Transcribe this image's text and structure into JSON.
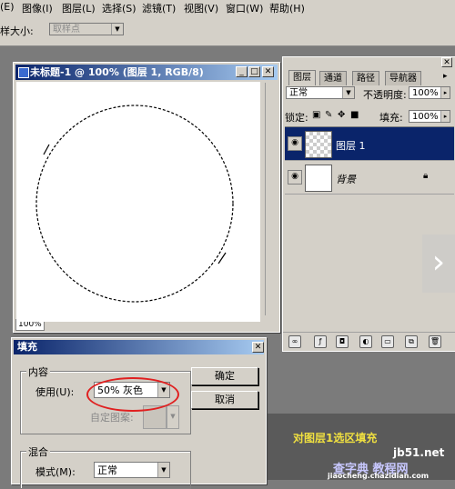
{
  "menu": {
    "items": [
      "(E)",
      "图像(I)",
      "图层(L)",
      "选择(S)",
      "滤镜(T)",
      "视图(V)",
      "窗口(W)",
      "帮助(H)"
    ]
  },
  "options": {
    "sample_label": "样大小:",
    "sample_value": "取样点"
  },
  "document": {
    "title": "未标题-1 @ 100% (图层 1, RGB/8)",
    "zoom": "100%"
  },
  "layers_panel": {
    "tabs": [
      "图层",
      "通道",
      "路径",
      "导航器"
    ],
    "blend_mode": "正常",
    "opacity_label": "不透明度:",
    "opacity_value": "100%",
    "lock_label": "锁定:",
    "fill_label": "填充:",
    "fill_value": "100%",
    "layers": [
      {
        "name": "图层 1",
        "selected": true
      },
      {
        "name": "背景",
        "selected": false
      }
    ]
  },
  "fill_dialog": {
    "title": "填充",
    "content_group": "内容",
    "use_label": "使用(U):",
    "use_value": "50% 灰色",
    "custom_pattern_label": "自定图案:",
    "ok_label": "确定",
    "cancel_label": "取消",
    "blend_group": "混合",
    "mode_label": "模式(M):",
    "mode_value": "正常"
  },
  "caption": "对图层1选区填充",
  "watermark": {
    "site_top": "jb51.net",
    "site_cn": "查字典 教程网",
    "site_bottom": "jiaocheng.chazidian.com"
  },
  "colors": {
    "title_start": "#0a246a",
    "title_end": "#a6caf0",
    "selected_layer": "#0a246a",
    "highlight": "#e02020",
    "caption": "#f0e040"
  }
}
